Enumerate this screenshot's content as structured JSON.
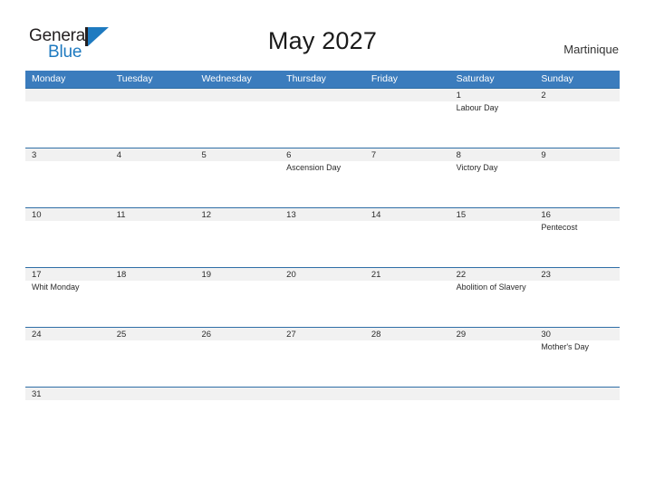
{
  "brand": {
    "word_one": "General",
    "word_two": "Blue",
    "mark_icon": "flag-triangle-icon",
    "accent_color": "#1e7ac0",
    "dark_color": "#231f20"
  },
  "header": {
    "title": "May 2027",
    "region": "Martinique"
  },
  "calendar": {
    "header_bg": "#3b7cbd",
    "row_divider_color": "#2f6ea6",
    "date_band_color": "#f1f1f1",
    "weekdays": [
      "Monday",
      "Tuesday",
      "Wednesday",
      "Thursday",
      "Friday",
      "Saturday",
      "Sunday"
    ],
    "weeks": [
      [
        {
          "date": "",
          "event": ""
        },
        {
          "date": "",
          "event": ""
        },
        {
          "date": "",
          "event": ""
        },
        {
          "date": "",
          "event": ""
        },
        {
          "date": "",
          "event": ""
        },
        {
          "date": "1",
          "event": "Labour Day"
        },
        {
          "date": "2",
          "event": ""
        }
      ],
      [
        {
          "date": "3",
          "event": ""
        },
        {
          "date": "4",
          "event": ""
        },
        {
          "date": "5",
          "event": ""
        },
        {
          "date": "6",
          "event": "Ascension Day"
        },
        {
          "date": "7",
          "event": ""
        },
        {
          "date": "8",
          "event": "Victory Day"
        },
        {
          "date": "9",
          "event": ""
        }
      ],
      [
        {
          "date": "10",
          "event": ""
        },
        {
          "date": "11",
          "event": ""
        },
        {
          "date": "12",
          "event": ""
        },
        {
          "date": "13",
          "event": ""
        },
        {
          "date": "14",
          "event": ""
        },
        {
          "date": "15",
          "event": ""
        },
        {
          "date": "16",
          "event": "Pentecost"
        }
      ],
      [
        {
          "date": "17",
          "event": "Whit Monday"
        },
        {
          "date": "18",
          "event": ""
        },
        {
          "date": "19",
          "event": ""
        },
        {
          "date": "20",
          "event": ""
        },
        {
          "date": "21",
          "event": ""
        },
        {
          "date": "22",
          "event": "Abolition of Slavery"
        },
        {
          "date": "23",
          "event": ""
        }
      ],
      [
        {
          "date": "24",
          "event": ""
        },
        {
          "date": "25",
          "event": ""
        },
        {
          "date": "26",
          "event": ""
        },
        {
          "date": "27",
          "event": ""
        },
        {
          "date": "28",
          "event": ""
        },
        {
          "date": "29",
          "event": ""
        },
        {
          "date": "30",
          "event": "Mother's Day"
        }
      ],
      [
        {
          "date": "31",
          "event": ""
        },
        {
          "date": "",
          "event": ""
        },
        {
          "date": "",
          "event": ""
        },
        {
          "date": "",
          "event": ""
        },
        {
          "date": "",
          "event": ""
        },
        {
          "date": "",
          "event": ""
        },
        {
          "date": "",
          "event": ""
        }
      ]
    ]
  }
}
